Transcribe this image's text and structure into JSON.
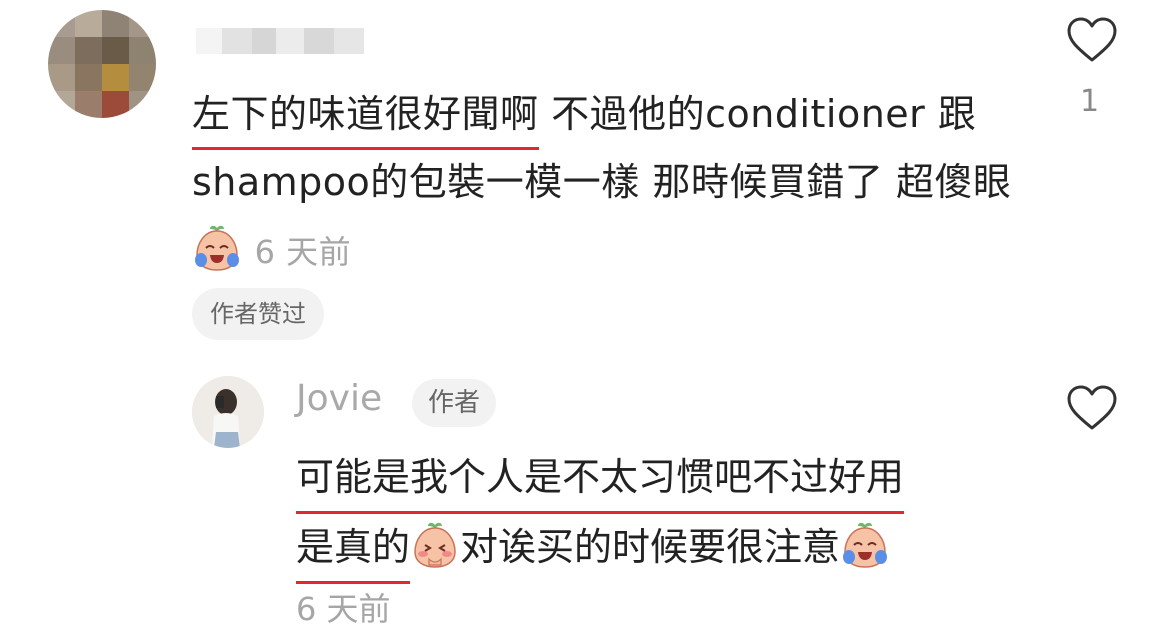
{
  "comment": {
    "text_segment_1": "左下的味道很好聞啊",
    "text_segment_2": " 不過他的conditioner 跟shampoo的包裝一模一樣 那時候買錯了 超傻眼",
    "time": "6 天前",
    "like_count": "1",
    "author_liked_label": "作者赞过",
    "emoji_icon": "crying-laughing-peach-emoji"
  },
  "reply": {
    "username": "Jovie",
    "author_tag": "作者",
    "text_segment_1": "可能是我个人是不太习惯吧不过好用",
    "text_segment_2": "是真的",
    "text_segment_3": "对诶买的时候要很注意",
    "time": "6 天前",
    "emoji_icons": [
      "blushing-peach-emoji",
      "crying-laughing-peach-emoji"
    ]
  },
  "colors": {
    "highlight_underline": "#e0282e",
    "secondary_text": "#a6a6a6",
    "pill_background": "#f2f2f2"
  }
}
